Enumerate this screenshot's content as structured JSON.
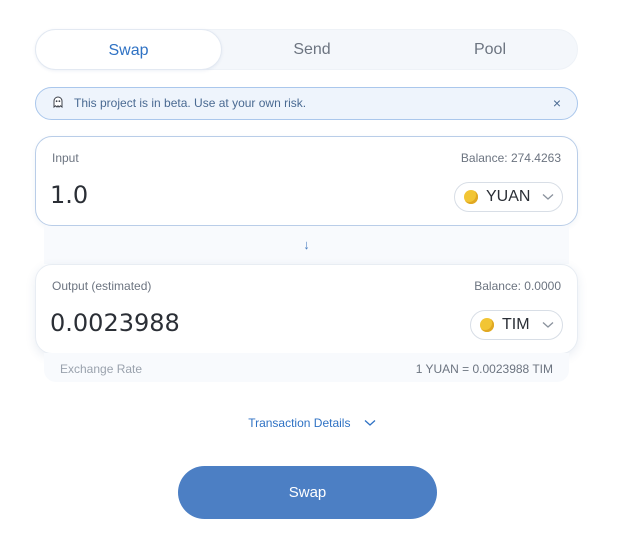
{
  "tabs": [
    {
      "label": "Swap",
      "active": true
    },
    {
      "label": "Send",
      "active": false
    },
    {
      "label": "Pool",
      "active": false
    }
  ],
  "banner": {
    "message": "This project is in beta. Use at your own risk.",
    "icon": "ghost-icon",
    "close_glyph": "×"
  },
  "input": {
    "label": "Input",
    "balance": "Balance: 274.4263",
    "amount": "1.0",
    "token": {
      "symbol": "YUAN",
      "icon": "token-emoji-icon"
    }
  },
  "arrow_glyph": "↓",
  "output": {
    "label": "Output (estimated)",
    "balance": "Balance: 0.0000",
    "amount": "0.0023988",
    "token": {
      "symbol": "TIM",
      "icon": "token-emoji-icon"
    }
  },
  "exchange_rate": {
    "label": "Exchange Rate",
    "value": "1 YUAN = 0.0023988 TIM"
  },
  "transaction_details": {
    "label": "Transaction Details"
  },
  "swap_button": {
    "label": "Swap"
  },
  "colors": {
    "accent": "#2f72c4",
    "button": "#4c7fc4",
    "banner_bg": "#eef4fc",
    "banner_border": "#aac7ec"
  }
}
